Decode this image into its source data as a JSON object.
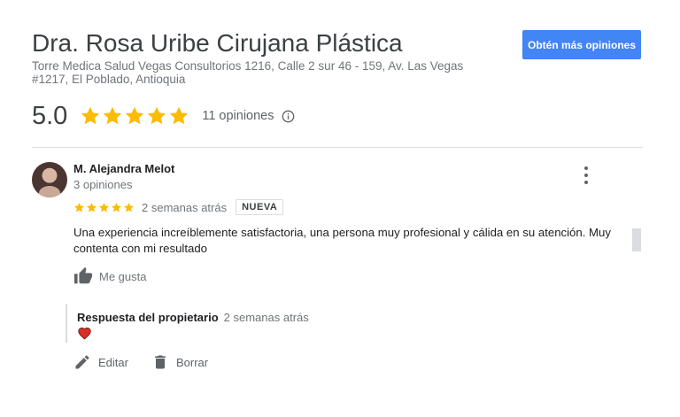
{
  "business": {
    "name": "Dra. Rosa Uribe Cirujana Plástica",
    "address": "Torre Medica Salud Vegas Consultorios 1216, Calle 2 sur 46 - 159, Av. Las Vegas #1217, El Poblado, Antioquia",
    "more_reviews_label": "Obtén más opiniones"
  },
  "rating": {
    "value": "5.0",
    "stars": 5,
    "reviews_count": "11 opiniones",
    "star_color": "#fbbc04"
  },
  "review": {
    "author": "M. Alejandra Melot",
    "author_reviews": "3 opiniones",
    "stars": 5,
    "time": "2 semanas atrás",
    "badge": "NUEVA",
    "text": "Una experiencia increíblemente satisfactoria, una persona muy profesional y cálida en su atención. Muy contenta con mi resultado",
    "like_label": "Me gusta",
    "owner_reply": {
      "label": "Respuesta del propietario",
      "time": "2 semanas atrás",
      "content_icon": "heart-icon"
    },
    "actions": {
      "edit_label": "Editar",
      "delete_label": "Borrar"
    }
  },
  "colors": {
    "accent": "#4285f4",
    "heart": "#d93025"
  }
}
